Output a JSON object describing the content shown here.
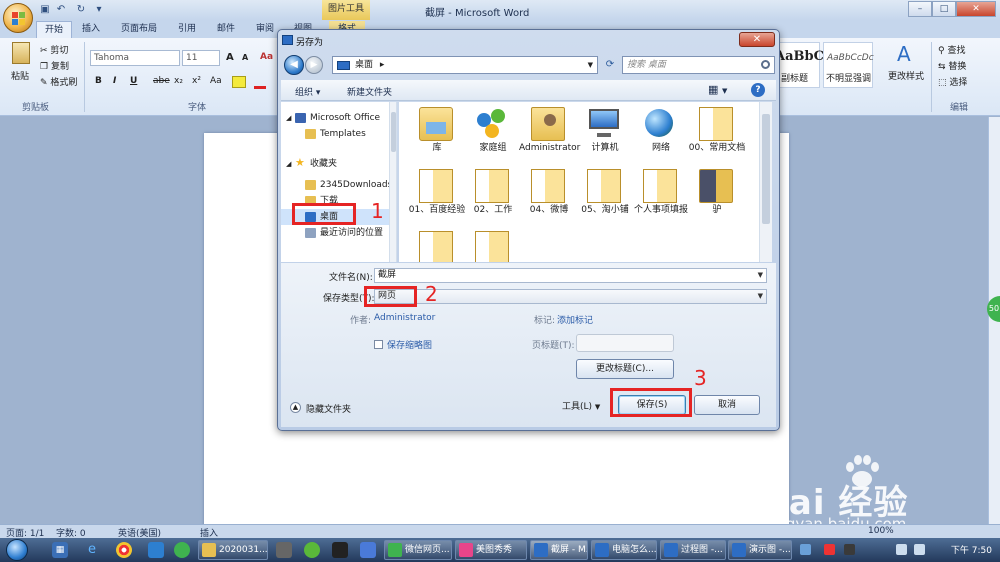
{
  "window": {
    "title": "截屏 - Microsoft Word",
    "context_tab_group": "图片工具",
    "controls": {
      "minimize": "–",
      "maximize": "□",
      "close": "✕"
    }
  },
  "ribbon": {
    "tabs": [
      "开始",
      "插入",
      "页面布局",
      "引用",
      "邮件",
      "审阅",
      "视图",
      "格式"
    ],
    "clipboard": {
      "paste": "粘贴",
      "cut": "剪切",
      "copy": "复制",
      "format_painter": "格式刷",
      "group": "剪贴板"
    },
    "font": {
      "name": "Tahoma",
      "size": "11",
      "group": "字体",
      "bold": "B",
      "italic": "I",
      "underline": "U",
      "strike": "abe",
      "subscript": "x₂",
      "superscript": "x²",
      "clear": "Aa",
      "grow": "A",
      "shrink": "A"
    },
    "styles": {
      "style1_preview": "AaBbC",
      "style1_name": "副标题",
      "style2_preview": "AaBbCcDc",
      "style2_name": "不明显强调",
      "change_styles": "更改样式"
    },
    "editing": {
      "find": "查找",
      "replace": "替换",
      "select": "选择",
      "group": "编辑"
    }
  },
  "dialog": {
    "title": "另存为",
    "close": "✕",
    "address": "桌面",
    "address_arrow": "▸",
    "search_placeholder": "搜索 桌面",
    "toolbar": {
      "organize": "组织 ▾",
      "new_folder": "新建文件夹",
      "help": "?"
    },
    "nav": [
      {
        "label": "Microsoft Office",
        "color": "#3a64b0"
      },
      {
        "label": "Templates",
        "color": "#e7bf52"
      },
      {
        "label": "收藏夹",
        "color": "#f3c530"
      },
      {
        "label": "2345Downloads",
        "color": "#e7bf52"
      },
      {
        "label": "下载",
        "color": "#e7bf52"
      },
      {
        "label": "桌面",
        "color": "#2d6dc4"
      },
      {
        "label": "最近访问的位置",
        "color": "#8ea2c0"
      }
    ],
    "files": [
      {
        "label": "库",
        "kind": "lib"
      },
      {
        "label": "家庭组",
        "kind": "home"
      },
      {
        "label": "Administrator",
        "kind": "user"
      },
      {
        "label": "计算机",
        "kind": "pc"
      },
      {
        "label": "网络",
        "kind": "net"
      },
      {
        "label": "00、常用文档",
        "kind": "folder"
      },
      {
        "label": "01、百度经验",
        "kind": "folder"
      },
      {
        "label": "02、工作",
        "kind": "folder"
      },
      {
        "label": "04、微博",
        "kind": "folder"
      },
      {
        "label": "05、淘小铺",
        "kind": "folder"
      },
      {
        "label": "个人事项填报",
        "kind": "folder"
      },
      {
        "label": "驴",
        "kind": "folder"
      },
      {
        "label": "",
        "kind": "folder"
      },
      {
        "label": "",
        "kind": "folder"
      }
    ],
    "form": {
      "filename_label": "文件名(N):",
      "filename_value": "截屏",
      "type_label": "保存类型(T):",
      "type_value": "网页",
      "author_label": "作者:",
      "author_value": "Administrator",
      "tags_label": "标记:",
      "tags_value": "添加标记",
      "thumbnail_label": "保存缩略图",
      "page_title_label": "页标题(T):",
      "change_title": "更改标题(C)...",
      "hide_folders": "隐藏文件夹",
      "tools": "工具(L)",
      "save": "保存(S)",
      "cancel": "取消"
    },
    "annotations": [
      "1",
      "2",
      "3"
    ]
  },
  "statusbar": {
    "page": "页面: 1/1",
    "words": "字数: 0",
    "lang": "英语(美国)",
    "mode": "插入",
    "zoom": "100%"
  },
  "taskbar": {
    "tasks": [
      "2020031...",
      "微信网页...",
      "美图秀秀",
      "截屏 - M...",
      "电脑怎么...",
      "过程图 -...",
      "演示图 -..."
    ],
    "clock": "下午 7:50"
  },
  "watermark": {
    "brand": "Bai 经验",
    "url": "jingyan.baidu.com"
  },
  "side_badge": "50"
}
